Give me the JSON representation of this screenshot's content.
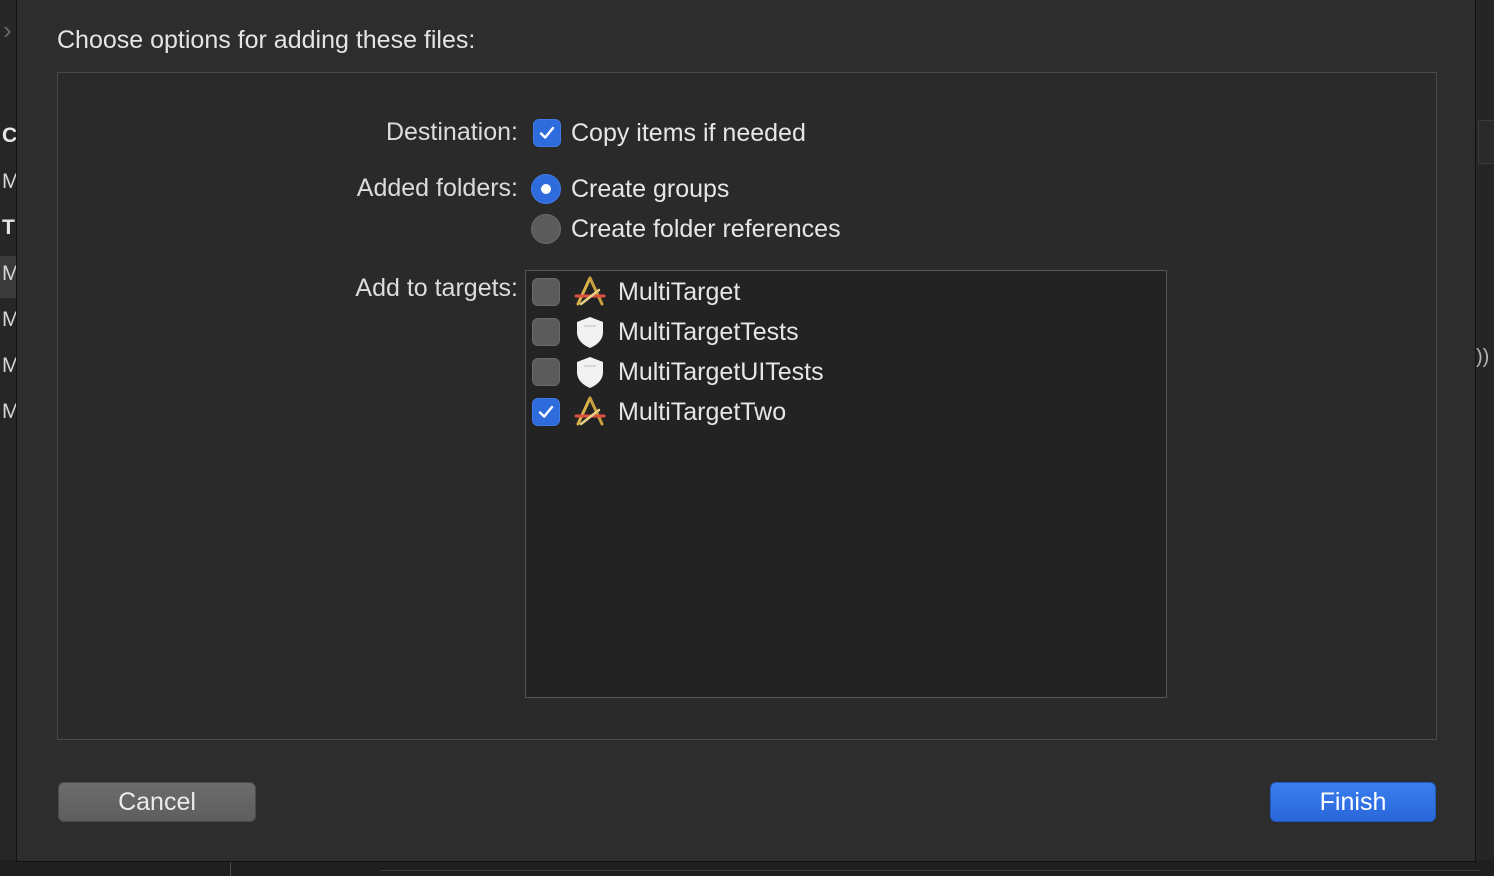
{
  "background": {
    "left_letters": [
      "C",
      "M",
      "T",
      "M",
      "M",
      "M",
      "M"
    ],
    "right_text": "))",
    "chevron": "›"
  },
  "dialog": {
    "title": "Choose options for adding these files:",
    "destination": {
      "label": "Destination:",
      "option_label": "Copy items if needed",
      "checked": true
    },
    "added_folders": {
      "label": "Added folders:",
      "options": [
        {
          "label": "Create groups",
          "selected": true
        },
        {
          "label": "Create folder references",
          "selected": false
        }
      ]
    },
    "add_to_targets": {
      "label": "Add to targets:",
      "targets": [
        {
          "name": "MultiTarget",
          "icon": "app-target-icon",
          "checked": false
        },
        {
          "name": "MultiTargetTests",
          "icon": "test-target-icon",
          "checked": false
        },
        {
          "name": "MultiTargetUITests",
          "icon": "test-target-icon",
          "checked": false
        },
        {
          "name": "MultiTargetTwo",
          "icon": "app-target-icon",
          "checked": true
        }
      ]
    },
    "buttons": {
      "cancel": "Cancel",
      "finish": "Finish"
    }
  },
  "colors": {
    "accent": "#2e6bdc",
    "sheet_background": "#2d2d2d"
  }
}
